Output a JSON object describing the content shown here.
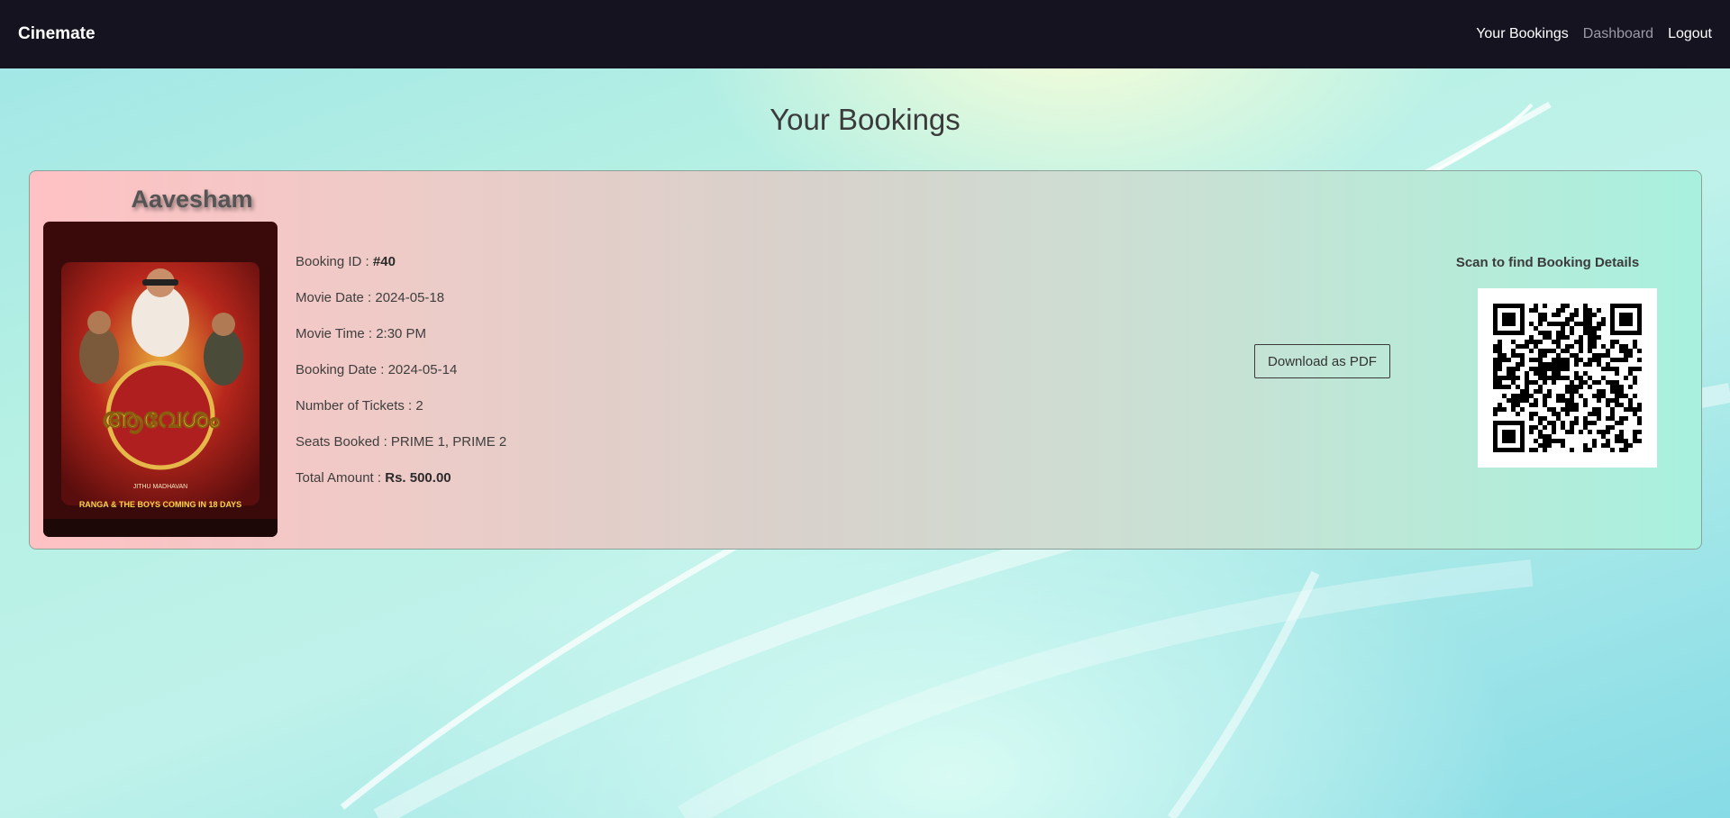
{
  "navbar": {
    "brand": "Cinemate",
    "links": [
      {
        "label": "Your Bookings"
      },
      {
        "label": "Dashboard"
      },
      {
        "label": "Logout"
      }
    ]
  },
  "page": {
    "title": "Your Bookings"
  },
  "booking": {
    "movie_title": "Aavesham",
    "poster_text": {
      "title_art": "ആവേശം",
      "tagline": "RANGA & THE BOYS COMING IN 18 DAYS",
      "director": "JITHU MADHAVAN"
    },
    "details": [
      {
        "label": "Booking ID : ",
        "value": "#40",
        "bold": true
      },
      {
        "label": "Movie Date : ",
        "value": "2024-05-18",
        "bold": false
      },
      {
        "label": "Movie Time : ",
        "value": "2:30 PM",
        "bold": false
      },
      {
        "label": "Booking Date : ",
        "value": "2024-05-14",
        "bold": false
      },
      {
        "label": "Number of Tickets : ",
        "value": "2",
        "bold": false
      },
      {
        "label": "Seats Booked : ",
        "value": "PRIME 1, PRIME 2",
        "bold": false
      },
      {
        "label": "Total Amount : ",
        "value": "Rs. 500.00",
        "bold": true
      }
    ],
    "download_label": "Download as PDF",
    "qr_label": "Scan to find Booking Details"
  },
  "colors": {
    "navbar_bg": "#15131f",
    "card_gradient_start": "#ffc1c4",
    "card_gradient_end": "#a9f0de"
  }
}
